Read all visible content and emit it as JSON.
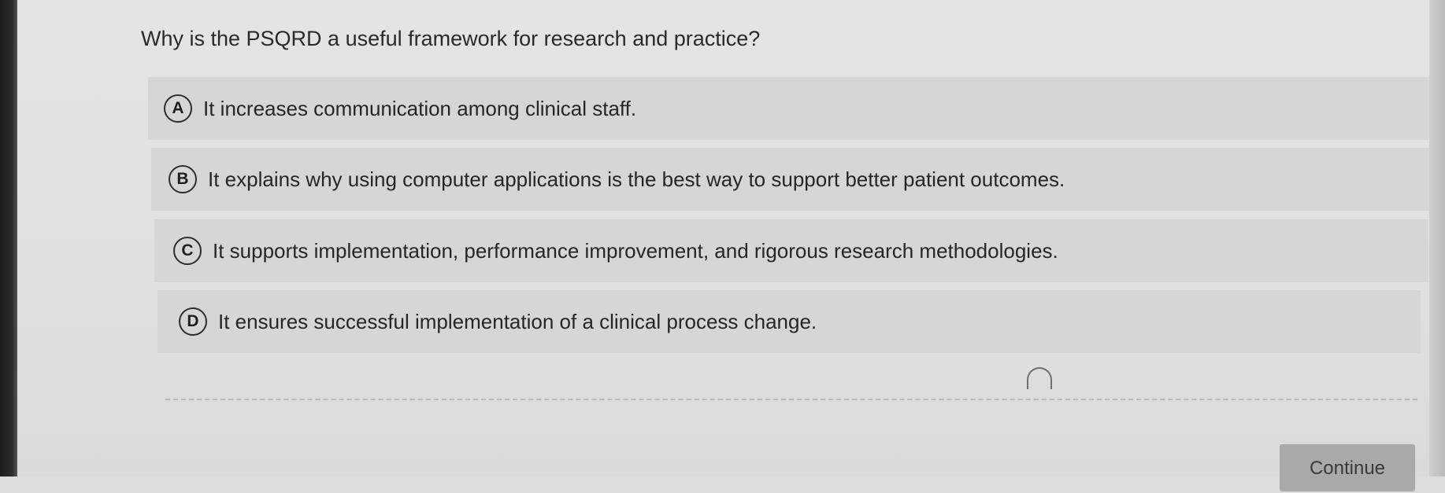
{
  "question": {
    "text": "Why is the PSQRD a useful framework for research and practice?"
  },
  "options": [
    {
      "letter": "A",
      "text": "It increases communication among clinical staff."
    },
    {
      "letter": "B",
      "text": "It explains why using computer applications is the best way to support better patient outcomes."
    },
    {
      "letter": "C",
      "text": "It supports implementation, performance improvement, and rigorous research methodologies."
    },
    {
      "letter": "D",
      "text": "It ensures successful implementation of a clinical process change."
    }
  ],
  "footer": {
    "continue_label": "Continue"
  },
  "colors": {
    "background": "#e2e2e0",
    "option_background": "#d6d6d4",
    "button_background": "#a9a9a7",
    "text": "#262626"
  }
}
